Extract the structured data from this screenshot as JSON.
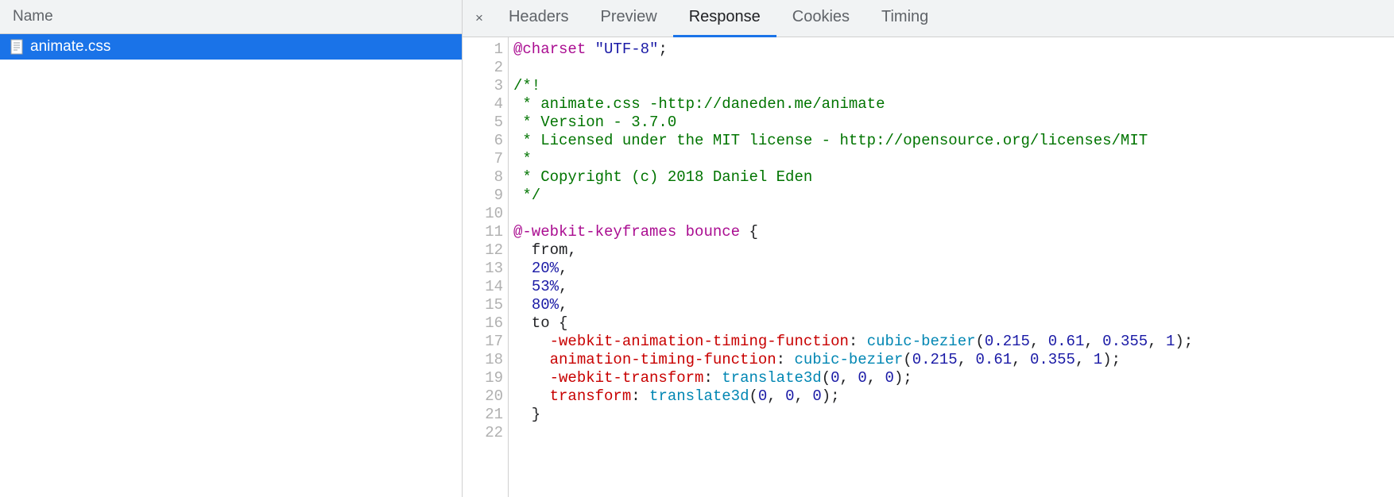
{
  "left": {
    "header": "Name",
    "files": [
      {
        "name": "animate.css",
        "selected": true
      }
    ]
  },
  "tabs": {
    "items": [
      {
        "label": "Headers",
        "active": false
      },
      {
        "label": "Preview",
        "active": false
      },
      {
        "label": "Response",
        "active": true
      },
      {
        "label": "Cookies",
        "active": false
      },
      {
        "label": "Timing",
        "active": false
      }
    ],
    "closeGlyph": "×"
  },
  "code": {
    "lines": [
      {
        "n": 1,
        "tokens": [
          [
            "atrule",
            "@charset "
          ],
          [
            "string",
            "\"UTF-8\""
          ],
          [
            "punc",
            ";"
          ]
        ]
      },
      {
        "n": 2,
        "tokens": []
      },
      {
        "n": 3,
        "tokens": [
          [
            "comment",
            "/*!"
          ]
        ]
      },
      {
        "n": 4,
        "tokens": [
          [
            "comment",
            " * animate.css -http://daneden.me/animate"
          ]
        ]
      },
      {
        "n": 5,
        "tokens": [
          [
            "comment",
            " * Version - 3.7.0"
          ]
        ]
      },
      {
        "n": 6,
        "tokens": [
          [
            "comment",
            " * Licensed under the MIT license - http://opensource.org/licenses/MIT"
          ]
        ]
      },
      {
        "n": 7,
        "tokens": [
          [
            "comment",
            " *"
          ]
        ]
      },
      {
        "n": 8,
        "tokens": [
          [
            "comment",
            " * Copyright (c) 2018 Daniel Eden"
          ]
        ]
      },
      {
        "n": 9,
        "tokens": [
          [
            "comment",
            " */"
          ]
        ]
      },
      {
        "n": 10,
        "tokens": []
      },
      {
        "n": 11,
        "tokens": [
          [
            "atrule",
            "@-webkit-keyframes bounce"
          ],
          [
            "punc",
            " {"
          ]
        ]
      },
      {
        "n": 12,
        "tokens": [
          [
            "selector",
            "  from,"
          ]
        ]
      },
      {
        "n": 13,
        "tokens": [
          [
            "punc",
            "  "
          ],
          [
            "number",
            "20%"
          ],
          [
            "punc",
            ","
          ]
        ]
      },
      {
        "n": 14,
        "tokens": [
          [
            "punc",
            "  "
          ],
          [
            "number",
            "53%"
          ],
          [
            "punc",
            ","
          ]
        ]
      },
      {
        "n": 15,
        "tokens": [
          [
            "punc",
            "  "
          ],
          [
            "number",
            "80%"
          ],
          [
            "punc",
            ","
          ]
        ]
      },
      {
        "n": 16,
        "tokens": [
          [
            "selector",
            "  to {"
          ]
        ]
      },
      {
        "n": 17,
        "tokens": [
          [
            "punc",
            "    "
          ],
          [
            "property",
            "-webkit-animation-timing-function"
          ],
          [
            "punc",
            ": "
          ],
          [
            "func",
            "cubic-bezier"
          ],
          [
            "punc",
            "("
          ],
          [
            "number",
            "0.215"
          ],
          [
            "punc",
            ", "
          ],
          [
            "number",
            "0.61"
          ],
          [
            "punc",
            ", "
          ],
          [
            "number",
            "0.355"
          ],
          [
            "punc",
            ", "
          ],
          [
            "number",
            "1"
          ],
          [
            "punc",
            ");"
          ]
        ]
      },
      {
        "n": 18,
        "tokens": [
          [
            "punc",
            "    "
          ],
          [
            "property",
            "animation-timing-function"
          ],
          [
            "punc",
            ": "
          ],
          [
            "func",
            "cubic-bezier"
          ],
          [
            "punc",
            "("
          ],
          [
            "number",
            "0.215"
          ],
          [
            "punc",
            ", "
          ],
          [
            "number",
            "0.61"
          ],
          [
            "punc",
            ", "
          ],
          [
            "number",
            "0.355"
          ],
          [
            "punc",
            ", "
          ],
          [
            "number",
            "1"
          ],
          [
            "punc",
            ");"
          ]
        ]
      },
      {
        "n": 19,
        "tokens": [
          [
            "punc",
            "    "
          ],
          [
            "property",
            "-webkit-transform"
          ],
          [
            "punc",
            ": "
          ],
          [
            "func",
            "translate3d"
          ],
          [
            "punc",
            "("
          ],
          [
            "number",
            "0"
          ],
          [
            "punc",
            ", "
          ],
          [
            "number",
            "0"
          ],
          [
            "punc",
            ", "
          ],
          [
            "number",
            "0"
          ],
          [
            "punc",
            ");"
          ]
        ]
      },
      {
        "n": 20,
        "tokens": [
          [
            "punc",
            "    "
          ],
          [
            "property",
            "transform"
          ],
          [
            "punc",
            ": "
          ],
          [
            "func",
            "translate3d"
          ],
          [
            "punc",
            "("
          ],
          [
            "number",
            "0"
          ],
          [
            "punc",
            ", "
          ],
          [
            "number",
            "0"
          ],
          [
            "punc",
            ", "
          ],
          [
            "number",
            "0"
          ],
          [
            "punc",
            ");"
          ]
        ]
      },
      {
        "n": 21,
        "tokens": [
          [
            "punc",
            "  }"
          ]
        ]
      },
      {
        "n": 22,
        "tokens": []
      }
    ]
  }
}
